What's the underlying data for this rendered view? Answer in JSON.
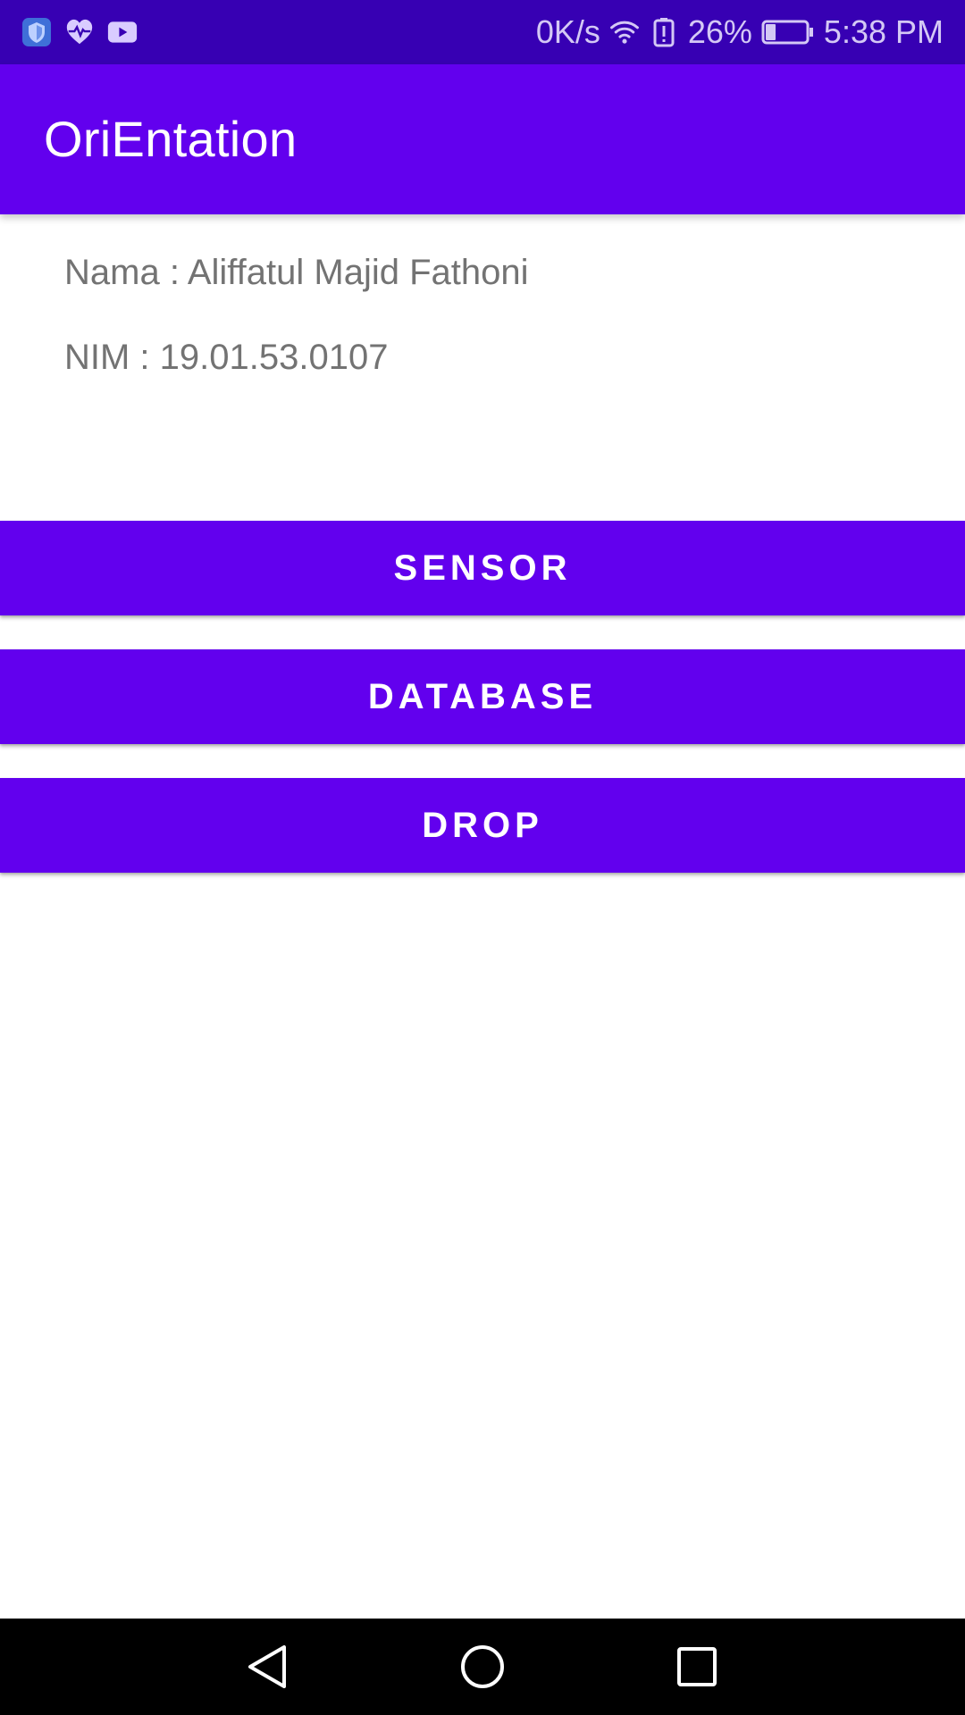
{
  "status_bar": {
    "icons_left": [
      "shield-icon",
      "health-heart-icon",
      "youtube-icon"
    ],
    "network_speed": "0K/s",
    "wifi_icon": "wifi-icon",
    "battery_alert_icon": "battery-alert-icon",
    "battery_percent": "26%",
    "battery_icon": "battery-icon",
    "battery_level": 0.26,
    "time": "5:38 PM",
    "background_color": "#3700b3"
  },
  "app_bar": {
    "title": "OriEntation",
    "background_color": "#6200ee"
  },
  "info": {
    "nama": "Nama : Aliffatul Majid Fathoni",
    "nim": "NIM : 19.01.53.0107"
  },
  "buttons": {
    "sensor": "SENSOR",
    "database": "DATABASE",
    "drop": "DROP",
    "color": "#6200ee"
  },
  "nav_bar": {
    "back_icon": "back-triangle-icon",
    "home_icon": "home-circle-icon",
    "recents_icon": "recents-square-icon"
  }
}
